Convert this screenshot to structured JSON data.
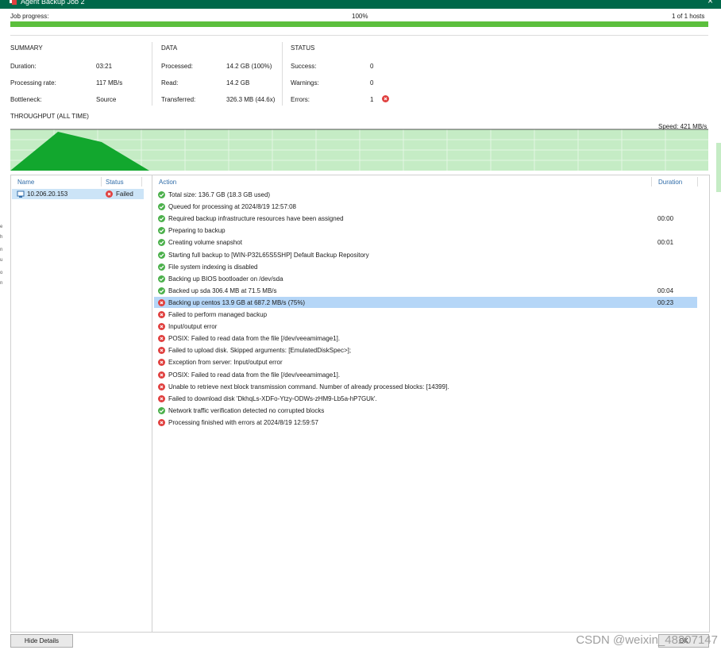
{
  "window": {
    "title": "Agent Backup Job 2",
    "close_glyph": "×"
  },
  "progress": {
    "label": "Job progress:",
    "percent_text": "100%",
    "hosts_text": "1 of 1 hosts",
    "fraction": 1.0,
    "color": "#5cbf3d"
  },
  "summary": {
    "header": "SUMMARY",
    "rows": [
      {
        "label": "Duration:",
        "value": "03:21"
      },
      {
        "label": "Processing rate:",
        "value": "117 MB/s"
      },
      {
        "label": "Bottleneck:",
        "value": "Source"
      }
    ]
  },
  "data_section": {
    "header": "DATA",
    "rows": [
      {
        "label": "Processed:",
        "value": "14.2 GB (100%)"
      },
      {
        "label": "Read:",
        "value": "14.2 GB"
      },
      {
        "label": "Transferred:",
        "value": "326.3 MB (44.6x)"
      }
    ]
  },
  "status_section": {
    "header": "STATUS",
    "rows": [
      {
        "label": "Success:",
        "value": "0",
        "icon": null
      },
      {
        "label": "Warnings:",
        "value": "0",
        "icon": null
      },
      {
        "label": "Errors:",
        "value": "1",
        "icon": "error-icon"
      }
    ]
  },
  "throughput": {
    "label": "THROUGHPUT (ALL TIME)",
    "speed": "Speed: 421 MB/s",
    "fill_color": "#c5ecc5",
    "peak_color": "#12a72e"
  },
  "hosts": {
    "columns": [
      "Name",
      "Status"
    ],
    "rows": [
      {
        "name": "10.206.20.153",
        "status": "Failed",
        "status_icon": "error-icon"
      }
    ]
  },
  "log": {
    "columns": [
      "Action",
      "Duration"
    ],
    "rows": [
      {
        "status": "ok",
        "text": "Total size: 136.7 GB (18.3 GB used)",
        "duration": ""
      },
      {
        "status": "ok",
        "text": "Queued for processing at 2024/8/19 12:57:08",
        "duration": ""
      },
      {
        "status": "ok",
        "text": "Required backup infrastructure resources have been assigned",
        "duration": "00:00"
      },
      {
        "status": "ok",
        "text": "Preparing to backup",
        "duration": ""
      },
      {
        "status": "ok",
        "text": "Creating volume snapshot",
        "duration": "00:01"
      },
      {
        "status": "ok",
        "text": "Starting full backup to [WIN-P32L65S5SHP] Default Backup Repository",
        "duration": ""
      },
      {
        "status": "ok",
        "text": "File system indexing is disabled",
        "duration": ""
      },
      {
        "status": "ok",
        "text": "Backing up BIOS bootloader on /dev/sda",
        "duration": ""
      },
      {
        "status": "ok",
        "text": "Backed up sda 306.4 MB at 71.5 MB/s",
        "duration": "00:04"
      },
      {
        "status": "err",
        "text": "Backing up centos 13.9 GB at 687.2 MB/s (75%)",
        "duration": "00:23",
        "selected": true
      },
      {
        "status": "err",
        "text": "Failed to perform managed backup",
        "duration": ""
      },
      {
        "status": "err",
        "text": "Input/output error",
        "duration": ""
      },
      {
        "status": "err",
        "text": "POSIX: Failed to read data from the file [/dev/veeamimage1].",
        "duration": ""
      },
      {
        "status": "err",
        "text": "Failed to upload disk. Skipped arguments: [EmulatedDiskSpec>];",
        "duration": ""
      },
      {
        "status": "err",
        "text": "Exception from server: Input/output error",
        "duration": ""
      },
      {
        "status": "err",
        "text": "POSIX: Failed to read data from the file [/dev/veeamimage1].",
        "duration": ""
      },
      {
        "status": "err",
        "text": "Unable to retrieve next block transmission command. Number of already processed blocks: [14399].",
        "duration": ""
      },
      {
        "status": "err",
        "text": "Failed to download disk 'DkhqLs-XDFo-Ytzy-ODWs-zHM9-Lb5a-hP7GUk'.",
        "duration": ""
      },
      {
        "status": "ok",
        "text": "Network traffic verification detected no corrupted blocks",
        "duration": ""
      },
      {
        "status": "err",
        "text": "Processing finished with errors at 2024/8/19 12:59:57",
        "duration": ""
      }
    ]
  },
  "buttons": {
    "hide_details": "Hide Details",
    "ok": "OK"
  },
  "watermark": "CSDN @weixin_48207147",
  "edge_fragments": [
    "e",
    "h",
    "n",
    "u",
    "o",
    "n"
  ],
  "colors": {
    "titlebar": "#00684a",
    "ok": "#4bb04b",
    "error": "#e0403f",
    "selection": "#b5d6f7",
    "header_link": "#2f6ca8"
  }
}
